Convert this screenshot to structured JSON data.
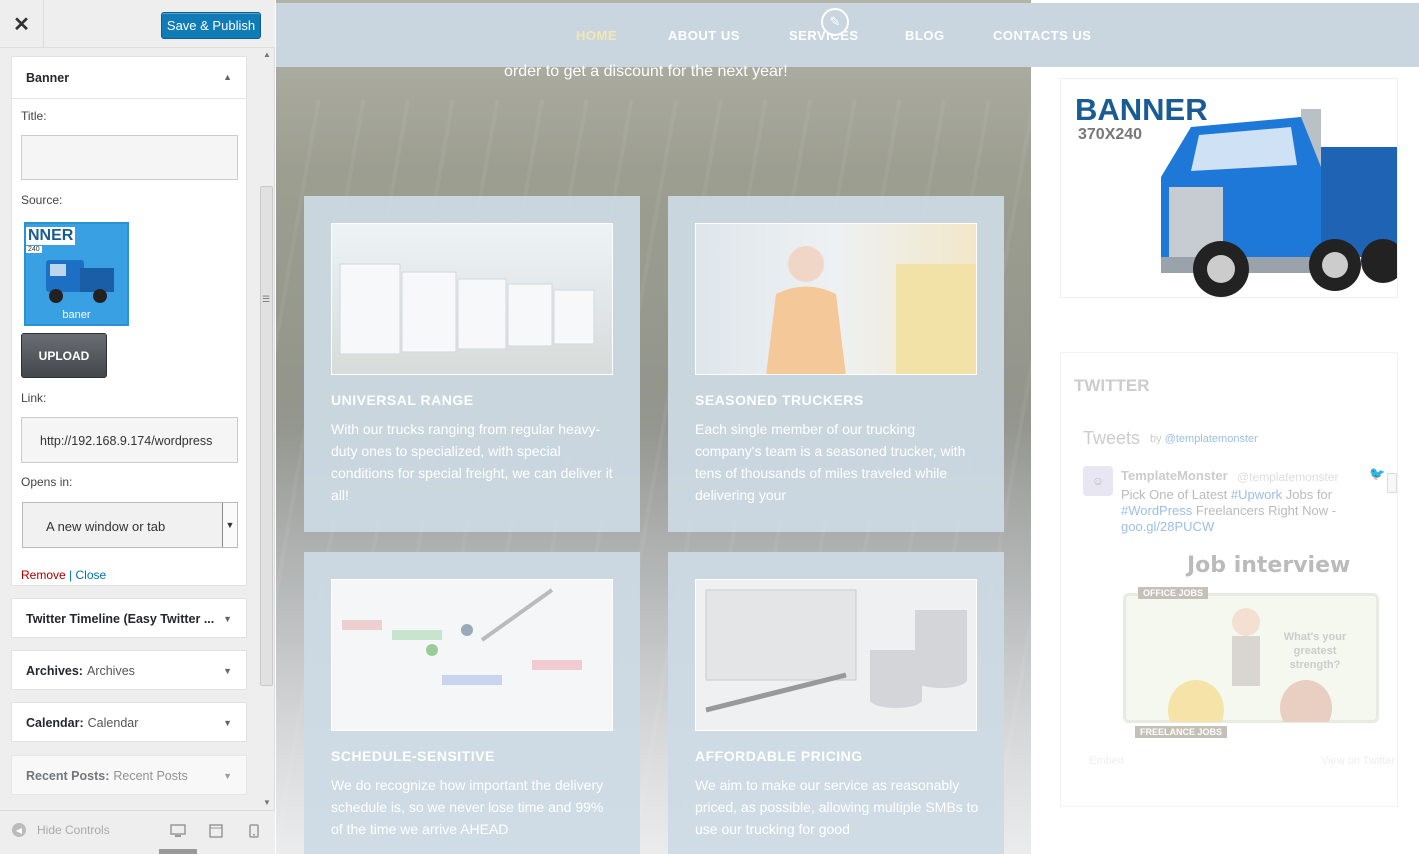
{
  "sidebar": {
    "close_icon": "close-icon",
    "publish_label": "Save & Publish",
    "banner_widget": {
      "title": "Banner",
      "title_label": "Title:",
      "title_value": "",
      "source_label": "Source:",
      "source_thumb_label": "baner",
      "source_thumb_text": "NNER",
      "source_thumb_text2": "240",
      "upload_label": "UPLOAD",
      "link_label": "Link:",
      "link_value": "http://192.168.9.174/wordpress",
      "opens_label": "Opens in:",
      "opens_value": "A new window or tab",
      "remove_label": "Remove",
      "separator": "|",
      "close_label": "Close"
    },
    "widgets": [
      {
        "title": "Twitter Timeline (Easy Twitter ...",
        "sub": ""
      },
      {
        "title": "Archives:",
        "sub": "Archives"
      },
      {
        "title": "Calendar:",
        "sub": "Calendar"
      },
      {
        "title": "Recent Posts:",
        "sub": "Recent Posts"
      }
    ],
    "footer": {
      "hide_label": "Hide Controls",
      "devices": [
        "desktop-icon",
        "tablet-icon",
        "mobile-icon"
      ]
    }
  },
  "preview": {
    "nav": [
      {
        "label": "HOME",
        "active": true
      },
      {
        "label": "ABOUT US",
        "active": false
      },
      {
        "label": "SERVICES",
        "active": false
      },
      {
        "label": "BLOG",
        "active": false
      },
      {
        "label": "CONTACTS US",
        "active": false
      }
    ],
    "hero_sub": "order to get a discount for the next year!",
    "cards": [
      {
        "title": "UNIVERSAL RANGE",
        "text": "With our trucks ranging from regular heavy-duty ones to specialized, with special conditions for special freight, we can deliver it all!"
      },
      {
        "title": "SEASONED TRUCKERS",
        "text": "Each single member of our trucking company's team is a seasoned trucker, with tens of thousands of miles traveled while delivering your"
      },
      {
        "title": "SCHEDULE-SENSITIVE",
        "text": "We do recognize how important the delivery schedule is, so we never lose time and 99% of the time we arrive AHEAD"
      },
      {
        "title": "AFFORDABLE PRICING",
        "text": "We aim to make our service as reasonably priced, as possible, allowing multiple SMBs to use our trucking for good"
      }
    ],
    "banner": {
      "title": "BANNER",
      "size": "370X240"
    },
    "twitter": {
      "heading": "TWITTER",
      "tweets_label": "Tweets",
      "by_prefix": "by",
      "by_handle": "@templatemonster",
      "name": "TemplateMonster",
      "handle": "@templatemonster",
      "text_1": "Pick One of Latest",
      "tag_1": "#Upwork",
      "text_2": "Jobs for",
      "tag_2": "#WordPress",
      "text_3": "Freelancers Right Now -",
      "link": "goo.gl/28PUCW",
      "image_title": "Job interview",
      "office_tag": "OFFICE JOBS",
      "speech": "What's your greatest strength?",
      "freelance_tag": "FREELANCE JOBS",
      "embed": "Embed",
      "view": "View on Twitter"
    }
  },
  "colors": {
    "publish": "#0f7cb8",
    "nav_active": "#f3e8b3",
    "banner_blue": "#1a5b93",
    "card_bg": "#cddae4"
  }
}
